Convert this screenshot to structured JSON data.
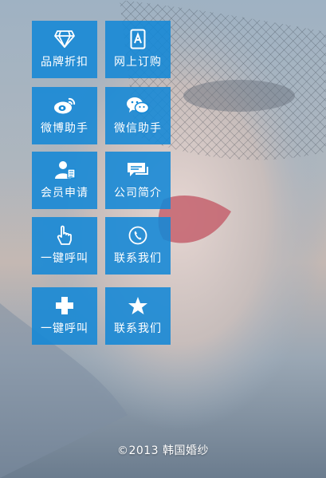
{
  "menu": [
    {
      "label": "品牌折扣",
      "icon": "diamond-icon"
    },
    {
      "label": "网上订购",
      "icon": "tablet-icon"
    },
    {
      "label": "微博助手",
      "icon": "weibo-icon"
    },
    {
      "label": "微信助手",
      "icon": "wechat-icon"
    },
    {
      "label": "会员申请",
      "icon": "member-icon"
    },
    {
      "label": "公司简介",
      "icon": "chat-bubble-icon"
    },
    {
      "label": "一键呼叫",
      "icon": "hand-pointer-icon"
    },
    {
      "label": "联系我们",
      "icon": "phone-icon"
    },
    {
      "label": "一键呼叫",
      "icon": "plus-icon"
    },
    {
      "label": "联系我们",
      "icon": "star-icon"
    }
  ],
  "footer": {
    "copyright": "©2013 韩国婚纱"
  },
  "colors": {
    "tile": "#1388d6"
  }
}
